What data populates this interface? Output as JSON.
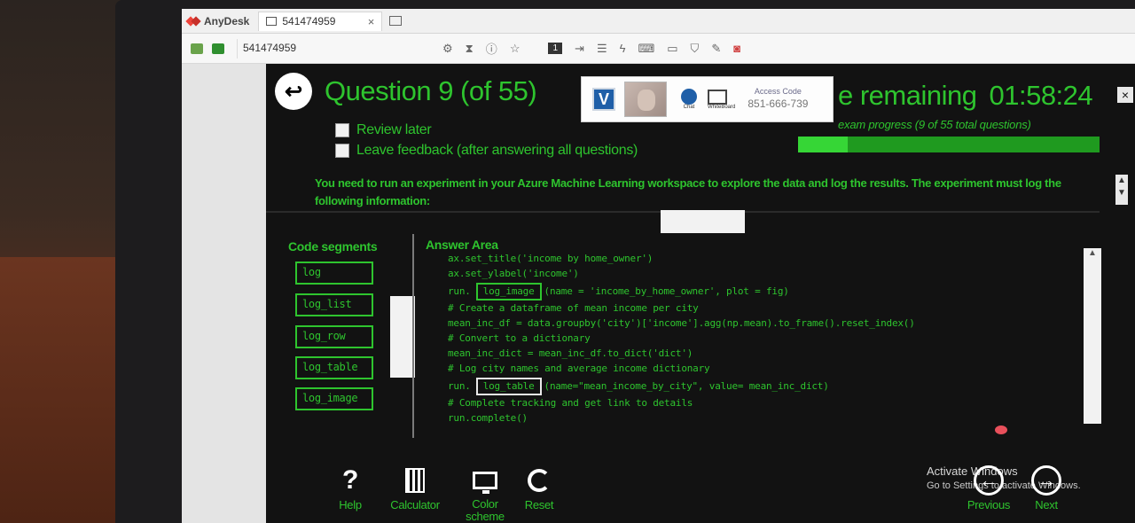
{
  "anydesk": {
    "app_name": "AnyDesk",
    "tab_label": "541474959",
    "address": "541474959",
    "toolbar_number": "1"
  },
  "session_popup": {
    "access_code_label": "Access Code",
    "access_code": "851-666-739",
    "chat_label": "Chat",
    "whiteboard_label": "WhiteBoard"
  },
  "exam": {
    "question_title": "Question 9 (of 55)",
    "review_later": "Review later",
    "leave_feedback": "Leave feedback (after answering all questions)",
    "time_remaining_label": "e remaining",
    "time_remaining": "01:58:24",
    "progress_label": "exam progress (9 of 55 total questions)",
    "progress_fraction": 0.164,
    "question_text": "You need to run an experiment in your Azure Machine Learning workspace to explore the data and log the results. The experiment must log the following information:",
    "segments_title": "Code segments",
    "segments": [
      "log",
      "log_list",
      "log_row",
      "log_table",
      "log_image"
    ],
    "answer_title": "Answer Area",
    "code": {
      "line1": "ax.set_title('income by home_owner')",
      "line2": "ax.set_ylabel('income')",
      "line3_prefix": "run.",
      "answer1": "log_image",
      "line3_suffix": "(name = 'income_by_home_owner', plot = fig)",
      "line4": "# Create a dataframe of mean income per city",
      "line5": "mean_inc_df = data.groupby('city')['income'].agg(np.mean).to_frame().reset_index()",
      "line6": "# Convert to a dictionary",
      "line7": "mean_inc_dict = mean_inc_df.to_dict('dict')",
      "line8": "# Log city names and average income dictionary",
      "line9_prefix": "run.",
      "answer2": "log_table",
      "line9_suffix": "(name=\"mean_income_by_city\", value= mean_inc_dict)",
      "line10": "# Complete tracking and get link to details",
      "line11": "run.complete()"
    },
    "bottom": {
      "help": "Help",
      "calculator": "Calculator",
      "color_scheme": "Color scheme",
      "reset": "Reset",
      "previous": "Previous",
      "next": "Next"
    },
    "watermark": {
      "line1": "Activate Windows",
      "line2": "Go to Settings to activate Windows."
    }
  },
  "colors": {
    "exam_green": "#2ec42e",
    "background": "#121212"
  }
}
